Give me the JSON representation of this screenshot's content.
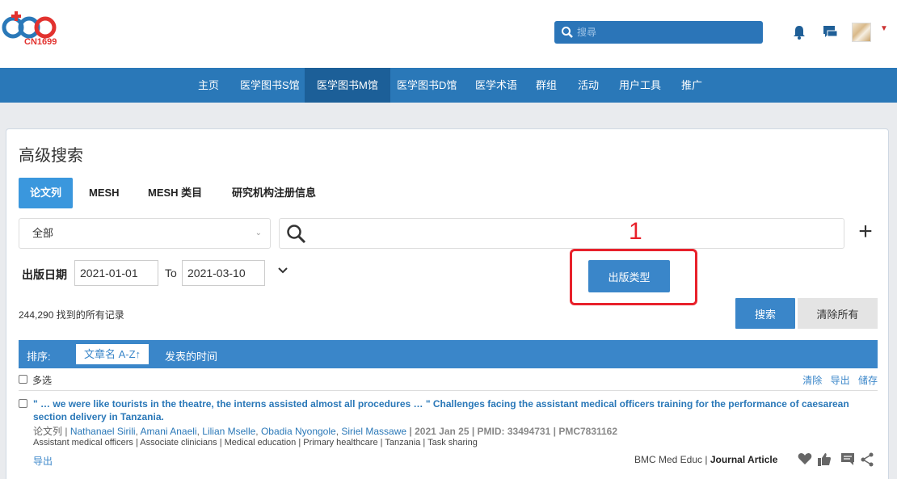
{
  "logo": {
    "text": "CN1699"
  },
  "header": {
    "search_placeholder": "搜尋"
  },
  "nav": {
    "items": [
      "主页",
      "医学图书S馆",
      "医学图书M馆",
      "医学图书D馆",
      "医学术语",
      "群组",
      "活动",
      "用户工具",
      "推广"
    ],
    "active": "医学图书M馆"
  },
  "page": {
    "title": "高级搜索"
  },
  "tabs": [
    "论文列",
    "MESH",
    "MESH 类目",
    "研究机构注册信息"
  ],
  "filter": {
    "select_value": "全部",
    "search_value": ""
  },
  "date": {
    "label": "出版日期",
    "from": "2021-01-01",
    "to_label": "To",
    "to": "2021-03-10"
  },
  "pub_type_button": "出版类型",
  "annotation": {
    "number": "1"
  },
  "result_count": "244,290 找到的所有记录",
  "buttons": {
    "search": "搜索",
    "clear_all": "清除所有"
  },
  "sort": {
    "label": "排序:",
    "option1": "文章名 A-Z↑",
    "option2": "发表的时间"
  },
  "select_bar": {
    "multi": "多选",
    "clear": "清除",
    "export": "导出",
    "save": "储存"
  },
  "results": [
    {
      "title": "\" … we were like tourists in the theatre, the interns assisted almost all procedures … \" Challenges facing the assistant medical officers training for the performance of caesarean section delivery in Tanzania.",
      "type": "论文列",
      "authors": [
        "Nathanael Sirili",
        "Amani Anaeli",
        "Lilian Mselle",
        "Obadia Nyongole",
        "Siriel Massawe"
      ],
      "date": "2021 Jan 25",
      "pmid": "PMID: 33494731",
      "pmc": "PMC7831162",
      "keywords": "Assistant medical officers | Associate clinicians | Medical education | Primary healthcare | Tanzania | Task sharing",
      "export": "导出",
      "journal": "BMC Med Educ",
      "article_type": "Journal Article"
    }
  ],
  "colors": {
    "nav": "#2a78b8",
    "accent": "#3a86c9",
    "annotation": "#e8212b"
  }
}
